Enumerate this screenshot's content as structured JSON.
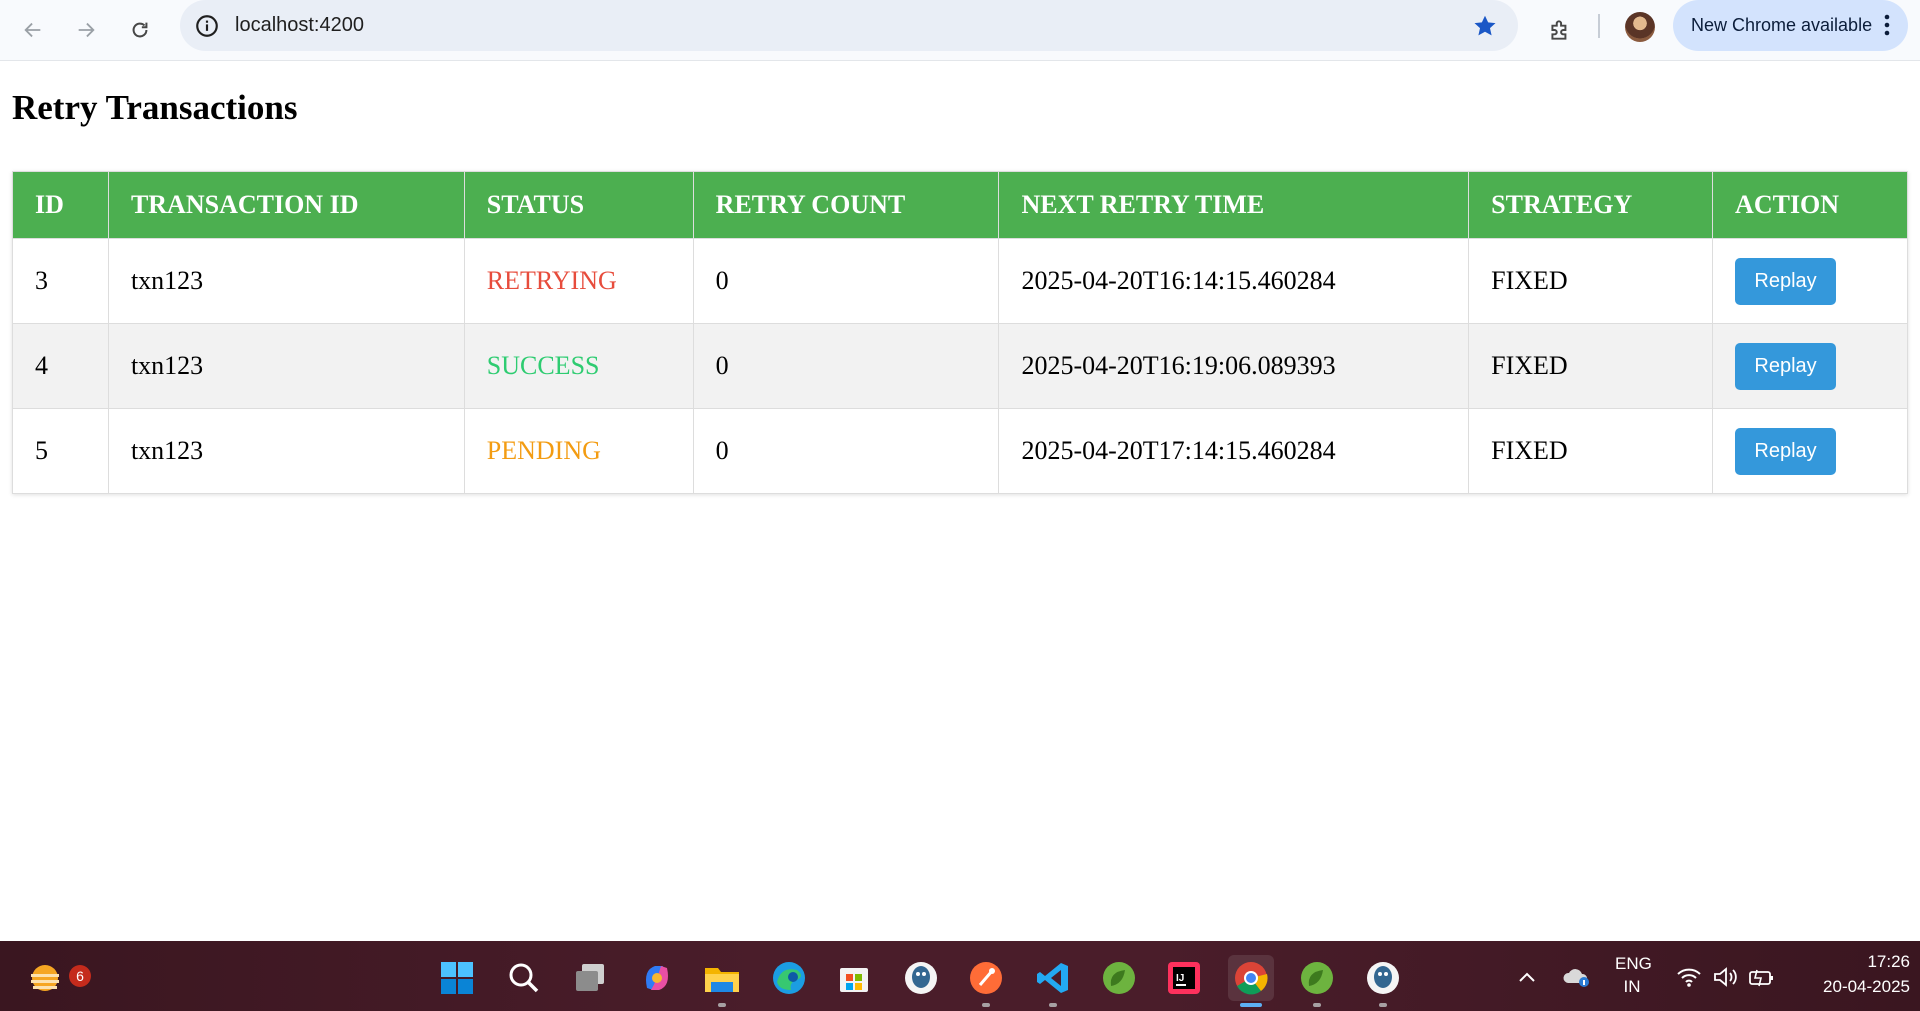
{
  "browser": {
    "url": "localhost:4200",
    "update_label": "New Chrome available"
  },
  "page": {
    "title": "Retry Transactions"
  },
  "table": {
    "columns": [
      "ID",
      "TRANSACTION ID",
      "STATUS",
      "RETRY COUNT",
      "NEXT RETRY TIME",
      "STRATEGY",
      "ACTION"
    ],
    "rows": [
      {
        "id": "3",
        "transaction_id": "txn123",
        "status": "RETRYING",
        "retry_count": "0",
        "next_retry_time": "2025-04-20T16:14:15.460284",
        "strategy": "FIXED",
        "action": "Replay"
      },
      {
        "id": "4",
        "transaction_id": "txn123",
        "status": "SUCCESS",
        "retry_count": "0",
        "next_retry_time": "2025-04-20T16:19:06.089393",
        "strategy": "FIXED",
        "action": "Replay"
      },
      {
        "id": "5",
        "transaction_id": "txn123",
        "status": "PENDING",
        "retry_count": "0",
        "next_retry_time": "2025-04-20T17:14:15.460284",
        "strategy": "FIXED",
        "action": "Replay"
      }
    ]
  },
  "colors": {
    "header_bg": "#4caf50",
    "retrying": "#e74c3c",
    "success": "#2ecc71",
    "pending": "#f39c12",
    "button": "#3498db"
  },
  "taskbar": {
    "weather_badge": "6",
    "lang_line1": "ENG",
    "lang_line2": "IN",
    "time": "17:26",
    "date": "20-04-2025",
    "apps": [
      "windows-start-icon",
      "search-icon",
      "task-view-icon",
      "copilot-icon",
      "file-explorer-icon",
      "edge-icon",
      "store-icon",
      "postgres-icon",
      "postman-icon",
      "vscode-icon",
      "spring-icon",
      "intellij-icon",
      "chrome-icon",
      "spring-icon",
      "postgres-icon"
    ]
  }
}
